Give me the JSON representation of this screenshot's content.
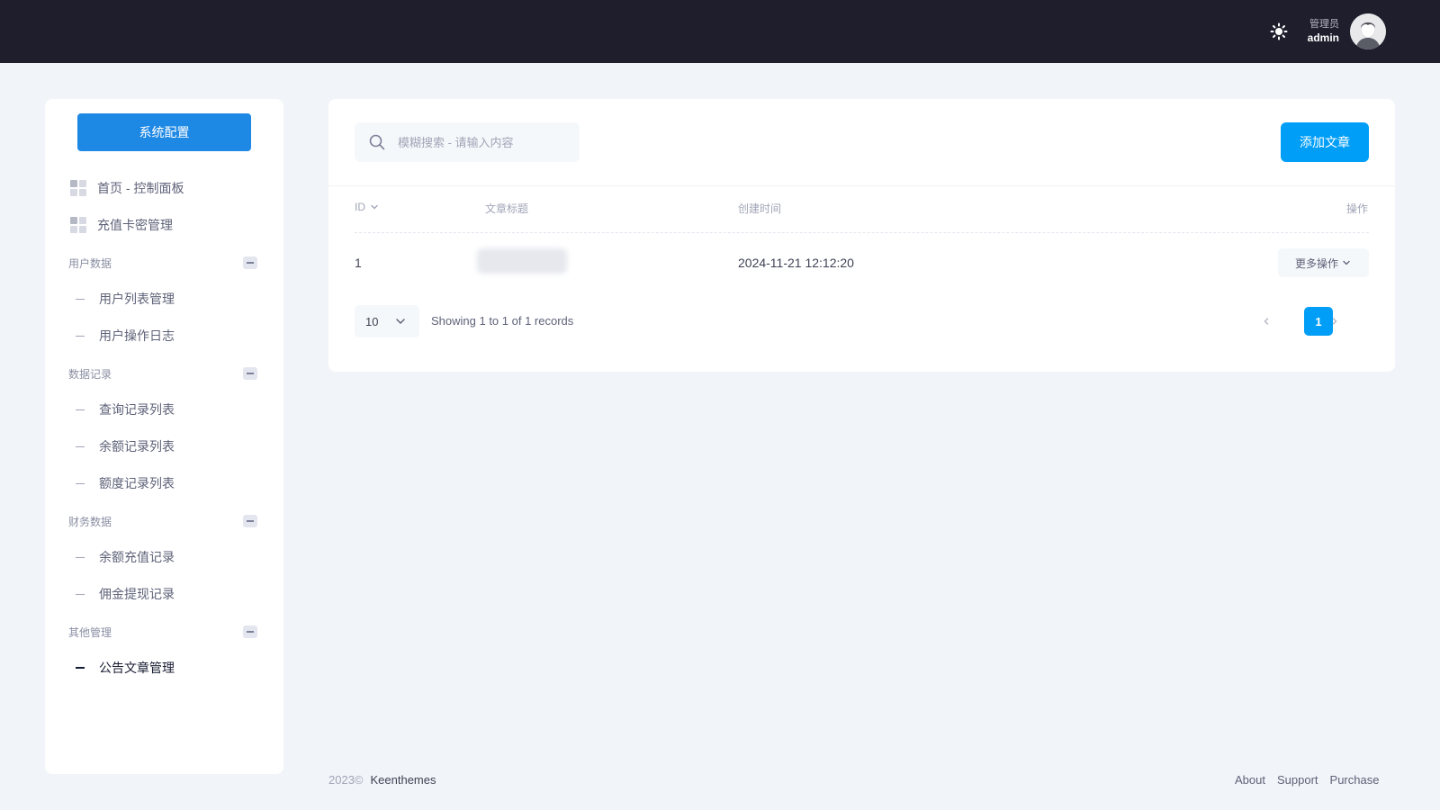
{
  "header": {
    "theme_icon": "sun-icon",
    "user_role": "管理员",
    "user_name": "admin"
  },
  "sidebar": {
    "config_button": "系统配置",
    "top_items": [
      {
        "label": "首页 - 控制面板",
        "icon": "dashboard-grid-icon"
      },
      {
        "label": "充值卡密管理",
        "icon": "dashboard-grid-icon"
      }
    ],
    "sections": [
      {
        "title": "用户数据",
        "items": [
          "用户列表管理",
          "用户操作日志"
        ]
      },
      {
        "title": "数据记录",
        "items": [
          "查询记录列表",
          "余额记录列表",
          "额度记录列表"
        ]
      },
      {
        "title": "财务数据",
        "items": [
          "余额充值记录",
          "佣金提现记录"
        ]
      },
      {
        "title": "其他管理",
        "items": [
          "公告文章管理"
        ]
      }
    ],
    "active_item": "公告文章管理"
  },
  "toolbar": {
    "search_placeholder": "模糊搜索 - 请输入内容",
    "add_button": "添加文章"
  },
  "table": {
    "columns": [
      "ID",
      "文章标题",
      "创建时间",
      "操作"
    ],
    "rows": [
      {
        "id": "1",
        "title": "",
        "created": "2024-11-21 12:12:20",
        "action": "更多操作"
      }
    ]
  },
  "pagination": {
    "page_size": "10",
    "info": "Showing 1 to 1 of 1 records",
    "current_page": "1"
  },
  "footer": {
    "year": "2023©",
    "brand": "Keenthemes",
    "links": [
      "About",
      "Support",
      "Purchase"
    ]
  },
  "colors": {
    "header_bg": "#1e1e2d",
    "primary": "#009ef7",
    "config_button": "#1e88e5",
    "page_bg": "#f1f4f8"
  }
}
